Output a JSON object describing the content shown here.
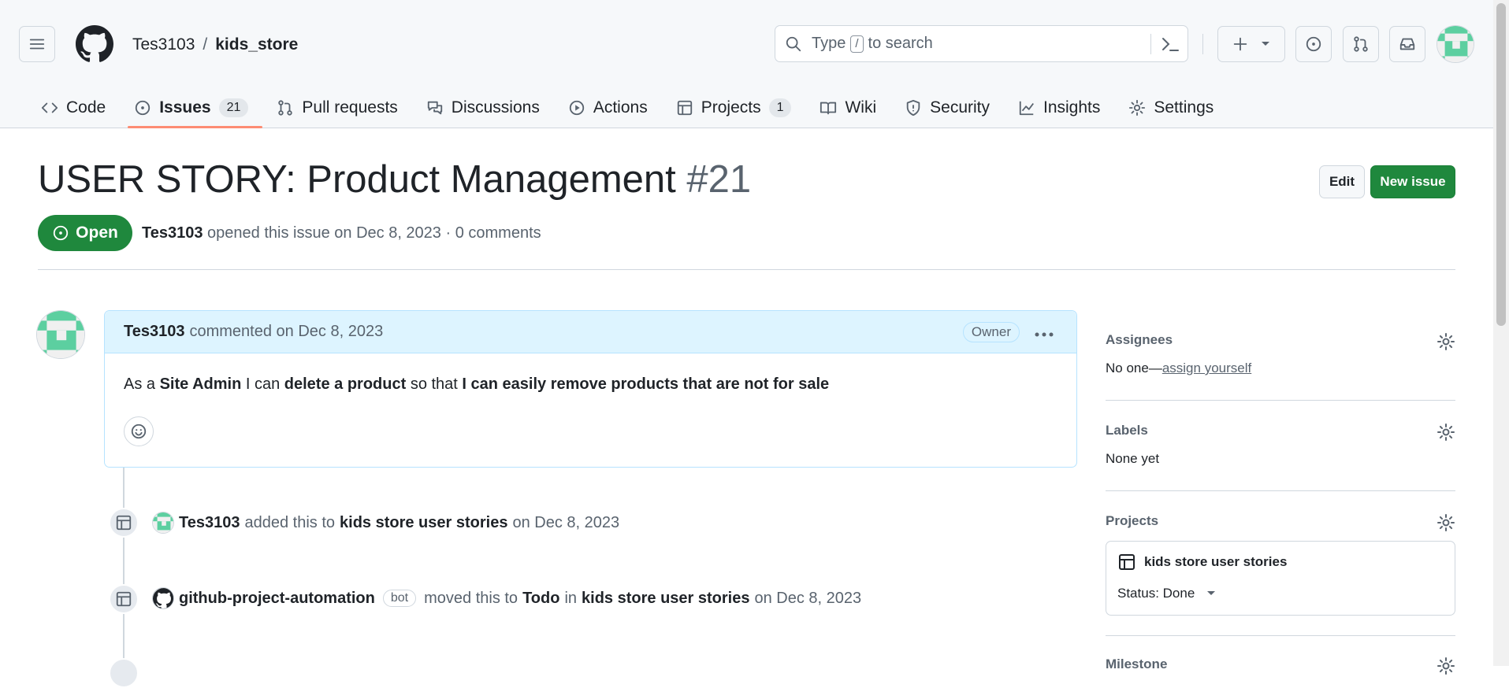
{
  "header": {
    "repo_owner": "Tes3103",
    "repo_sep": "/",
    "repo_name": "kids_store",
    "search_prefix": "Type",
    "search_key": "/",
    "search_suffix": "to search"
  },
  "tabs": [
    {
      "label": "Code",
      "icon": "code-icon"
    },
    {
      "label": "Issues",
      "count": "21",
      "icon": "issue-icon"
    },
    {
      "label": "Pull requests",
      "icon": "pull-request-icon"
    },
    {
      "label": "Discussions",
      "icon": "discussion-icon"
    },
    {
      "label": "Actions",
      "icon": "play-icon"
    },
    {
      "label": "Projects",
      "count": "1",
      "icon": "table-icon"
    },
    {
      "label": "Wiki",
      "icon": "book-icon"
    },
    {
      "label": "Security",
      "icon": "shield-icon"
    },
    {
      "label": "Insights",
      "icon": "graph-icon"
    },
    {
      "label": "Settings",
      "icon": "gear-icon"
    }
  ],
  "issue": {
    "title": "USER STORY: Product Management",
    "number": "#21",
    "state": "Open",
    "author": "Tes3103",
    "meta_text": "opened this issue on Dec 8, 2023 · 0 comments",
    "edit_label": "Edit",
    "new_issue_label": "New issue"
  },
  "comment": {
    "author": "Tes3103",
    "meta": "commented on Dec 8, 2023",
    "badge": "Owner",
    "body": {
      "t1": "As a ",
      "b1": "Site Admin",
      "t2": " I can ",
      "b2": "delete a product",
      "t3": " so that ",
      "b3": "I can easily remove products that are not for sale"
    }
  },
  "timeline": [
    {
      "actor": "Tes3103",
      "text1": "added this to",
      "project": "kids store user stories",
      "date": "on Dec 8, 2023"
    },
    {
      "actor": "github-project-automation",
      "bot": "bot",
      "text1": "moved this to",
      "column": "Todo",
      "text2": "in",
      "project": "kids store user stories",
      "date": "on Dec 8, 2023"
    }
  ],
  "sidebar": {
    "assignees": {
      "title": "Assignees",
      "value": "No one—",
      "link": "assign yourself"
    },
    "labels": {
      "title": "Labels",
      "value": "None yet"
    },
    "projects": {
      "title": "Projects",
      "project_name": "kids store user stories",
      "status": "Status: Done"
    },
    "milestone": {
      "title": "Milestone"
    }
  },
  "colors": {
    "accent_green": "#1f883d",
    "tab_underline": "#fd8c73",
    "comment_header": "#ddf4ff"
  }
}
